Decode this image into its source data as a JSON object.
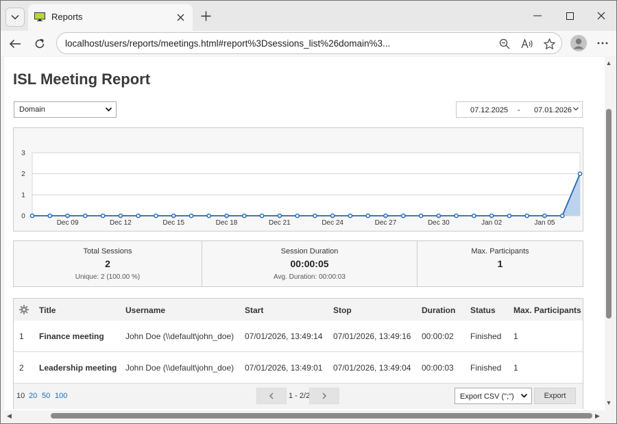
{
  "browser": {
    "tab_title": "Reports",
    "url": "localhost/users/reports/meetings.html#report%3Dsessions_list%26domain%3..."
  },
  "page": {
    "title": "ISL Meeting Report",
    "domain_select": "Domain",
    "date_from": "07.12.2025",
    "date_sep": "-",
    "date_to": "07.01.2026"
  },
  "chart_data": {
    "type": "area",
    "x_tick_labels": [
      "Dec 09",
      "Dec 12",
      "Dec 15",
      "Dec 18",
      "Dec 21",
      "Dec 24",
      "Dec 27",
      "Dec 30",
      "Jan 02",
      "Jan 05"
    ],
    "y_ticks": [
      0,
      1,
      2,
      3
    ],
    "ylim": [
      0,
      3
    ],
    "grid": true,
    "values": [
      0,
      0,
      0,
      0,
      0,
      0,
      0,
      0,
      0,
      0,
      0,
      0,
      0,
      0,
      0,
      0,
      0,
      0,
      0,
      0,
      0,
      0,
      0,
      0,
      0,
      0,
      0,
      0,
      0,
      0,
      0,
      2
    ],
    "series_color": "#1f66b3",
    "fill_color": "#bcd3ee"
  },
  "stats": [
    {
      "label": "Total Sessions",
      "value": "2",
      "sub": "Unique: 2 (100.00 %)"
    },
    {
      "label": "Session Duration",
      "value": "00:00:05",
      "sub": "Avg. Duration: 00:00:03"
    },
    {
      "label": "Max. Participants",
      "value": "1",
      "sub": ""
    }
  ],
  "table": {
    "headers": {
      "title": "Title",
      "username": "Username",
      "start": "Start",
      "stop": "Stop",
      "duration": "Duration",
      "status": "Status",
      "max_participants": "Max. Participants"
    },
    "rows": [
      {
        "num": "1",
        "title": "Finance meeting",
        "username": "John Doe (\\\\default\\john_doe)",
        "start": "07/01/2026, 13:49:14",
        "stop": "07/01/2026, 13:49:16",
        "duration": "00:00:02",
        "status": "Finished",
        "max_participants": "1"
      },
      {
        "num": "2",
        "title": "Leadership meeting",
        "username": "John Doe (\\\\default\\john_doe)",
        "start": "07/01/2026, 13:49:01",
        "stop": "07/01/2026, 13:49:04",
        "duration": "00:00:03",
        "status": "Finished",
        "max_participants": "1"
      }
    ],
    "page_sizes": [
      "10",
      "20",
      "50",
      "100"
    ],
    "pager_info": "1 - 2/2",
    "export_format": "Export CSV (\";\")",
    "export_label": "Export"
  }
}
